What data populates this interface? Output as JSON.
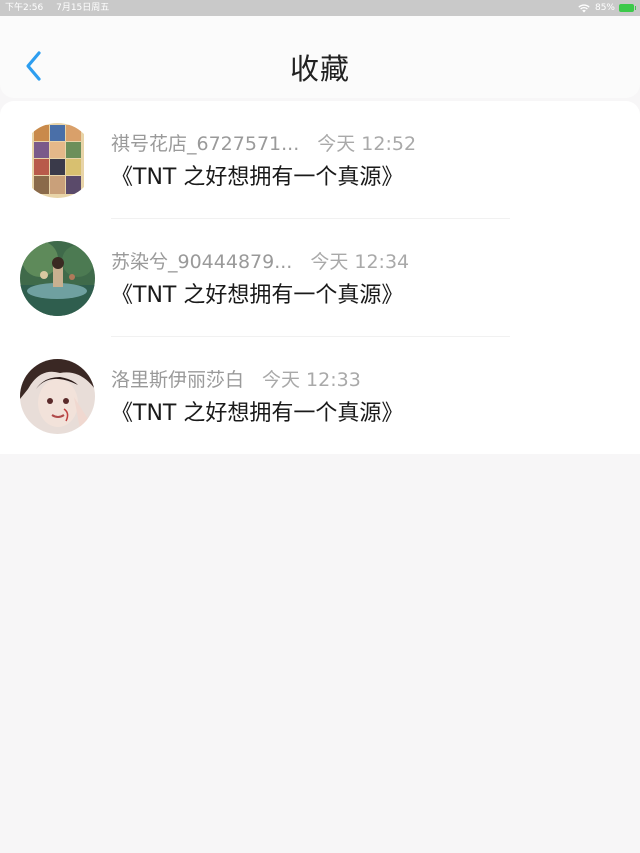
{
  "status_bar": {
    "time": "下午2:56",
    "date": "7月15日周五",
    "battery": "85%"
  },
  "nav": {
    "title": "收藏",
    "back_icon": "chevron-left-icon",
    "accent": "#2d9ef0"
  },
  "items": [
    {
      "user": "祺号花店_6727571...",
      "time": "今天 12:52",
      "title": "《TNT 之好想拥有一个真源》"
    },
    {
      "user": "苏染兮_90444879...",
      "time": "今天 12:34",
      "title": "《TNT 之好想拥有一个真源》"
    },
    {
      "user": "洛里斯伊丽莎白",
      "time": "今天 12:33",
      "title": "《TNT 之好想拥有一个真源》"
    }
  ]
}
